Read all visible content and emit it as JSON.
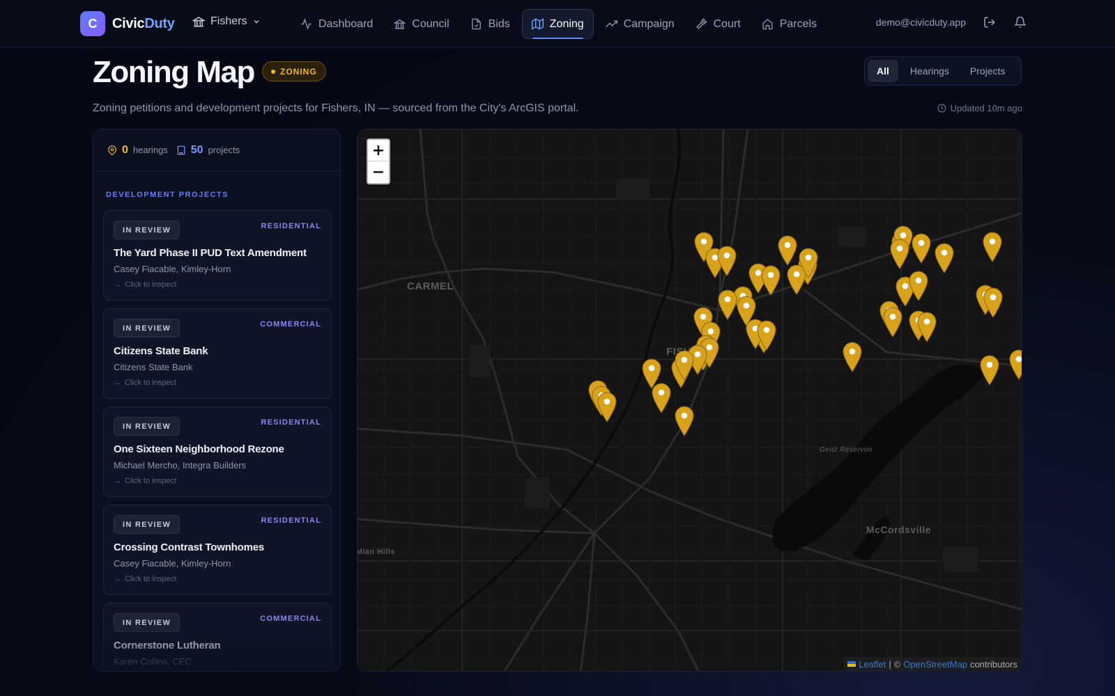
{
  "app": {
    "brand_prefix": "Civic",
    "brand_suffix": "Duty",
    "logo_letter": "C",
    "city": "Fishers"
  },
  "nav": {
    "items": [
      {
        "label": "Dashboard",
        "icon": "activity-icon"
      },
      {
        "label": "Council",
        "icon": "landmark-icon"
      },
      {
        "label": "Bids",
        "icon": "file-check-icon"
      },
      {
        "label": "Zoning",
        "icon": "map-icon",
        "active": true
      },
      {
        "label": "Campaign",
        "icon": "trending-up-icon"
      },
      {
        "label": "Court",
        "icon": "gavel-icon"
      },
      {
        "label": "Parcels",
        "icon": "home-icon"
      }
    ],
    "user_email": "demo@civicduty.app"
  },
  "header": {
    "title": "Zoning Map",
    "badge": "ZONING",
    "subtitle": "Zoning petitions and development projects for Fishers, IN — sourced from the City's ArcGIS portal.",
    "updated": "Updated 10m ago",
    "filters": [
      "All",
      "Hearings",
      "Projects"
    ],
    "active_filter": "All"
  },
  "sidebar": {
    "hearings_count": "0",
    "hearings_label": "hearings",
    "projects_count": "50",
    "projects_label": "projects",
    "section_label": "DEVELOPMENT PROJECTS",
    "hint": "Click to inspect",
    "projects": [
      {
        "status": "IN REVIEW",
        "category": "RESIDENTIAL",
        "name": "The Yard Phase II PUD Text Amendment",
        "who": "Casey Fiacable, Kimley-Horn"
      },
      {
        "status": "IN REVIEW",
        "category": "COMMERCIAL",
        "name": "Citizens State Bank",
        "who": "Citizens State Bank"
      },
      {
        "status": "IN REVIEW",
        "category": "RESIDENTIAL",
        "name": "One Sixteen Neighborhood Rezone",
        "who": "Michael Mercho, Integra Builders"
      },
      {
        "status": "IN REVIEW",
        "category": "RESIDENTIAL",
        "name": "Crossing Contrast Townhomes",
        "who": "Casey Fiacable, Kimley-Horn"
      },
      {
        "status": "IN REVIEW",
        "category": "COMMERCIAL",
        "name": "Cornerstone Lutheran",
        "who": "Karen Collins, CEC"
      }
    ]
  },
  "map": {
    "labels": {
      "carmel": "CARMEL",
      "fishers": "FISH",
      "geist": "Geist Reservoir",
      "mccordsville": "McCordsville",
      "indian_hills": "dian Hills"
    },
    "attribution": {
      "leaflet": "Leaflet",
      "separator": "|",
      "copyright": "©",
      "osm": "OpenStreetMap",
      "contributors": "contributors"
    },
    "zoom_in": "+",
    "zoom_out": "−"
  },
  "colors": {
    "accent": "#5b8cff",
    "pin": "#d9a21b",
    "zoning_badge": "#f2b91d",
    "category": "#8a86f2"
  }
}
